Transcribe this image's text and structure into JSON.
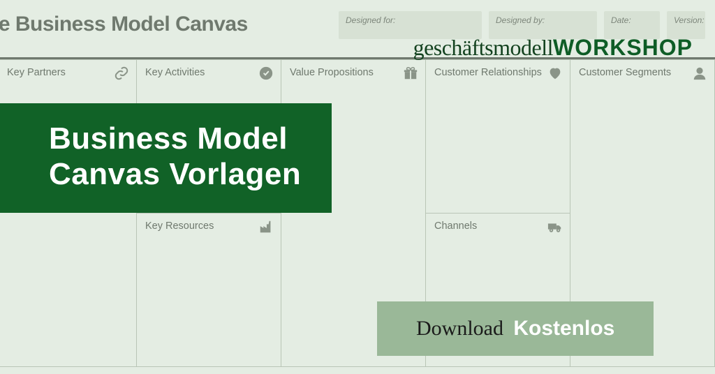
{
  "header": {
    "title": "ne Business Model Canvas",
    "meta": {
      "designed_for": "Designed for:",
      "designed_by": "Designed by:",
      "date": "Date:",
      "version": "Version:"
    }
  },
  "brand": {
    "light": "geschäftsmodell",
    "heavy": "WORKSHOP"
  },
  "cells": {
    "key_partners": "Key Partners",
    "key_activities": "Key Activities",
    "key_resources": "Key Resources",
    "value_propositions": "Value Propositions",
    "customer_relationships": "Customer Relationships",
    "channels": "Channels",
    "customer_segments": "Customer Segments"
  },
  "overlay": {
    "title_line1": "Business Model",
    "title_line2": "Canvas Vorlagen",
    "download": "Download",
    "free": "Kostenlos"
  }
}
